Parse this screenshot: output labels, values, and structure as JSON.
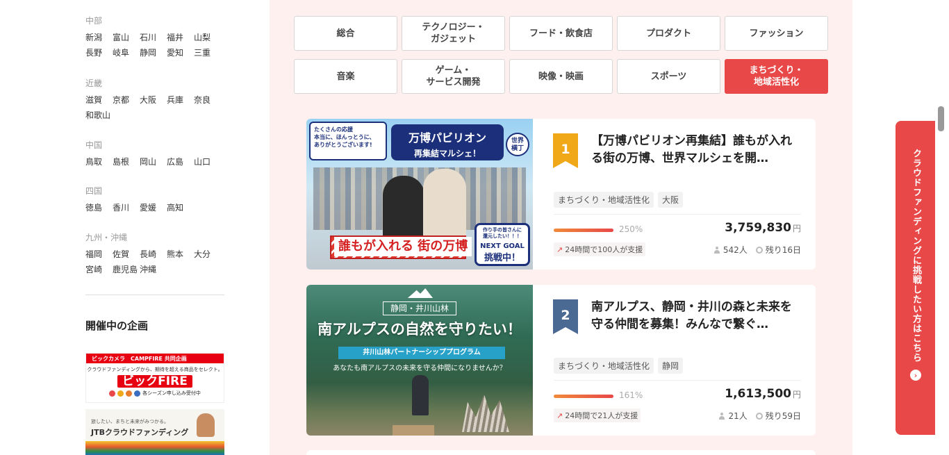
{
  "regions": [
    {
      "name": "中部",
      "rows": [
        [
          "新潟",
          "富山",
          "石川",
          "福井",
          "山梨"
        ],
        [
          "長野",
          "岐阜",
          "静岡",
          "愛知",
          "三重"
        ]
      ]
    },
    {
      "name": "近畿",
      "rows": [
        [
          "滋賀",
          "京都",
          "大阪",
          "兵庫",
          "奈良"
        ],
        [
          "和歌山"
        ]
      ]
    },
    {
      "name": "中国",
      "rows": [
        [
          "鳥取",
          "島根",
          "岡山",
          "広島",
          "山口"
        ]
      ]
    },
    {
      "name": "四国",
      "rows": [
        [
          "徳島",
          "香川",
          "愛媛",
          "高知"
        ]
      ]
    },
    {
      "name": "九州・沖縄",
      "rows": [
        [
          "福岡",
          "佐賀",
          "長崎",
          "熊本",
          "大分"
        ],
        [
          "宮崎",
          "鹿児島",
          "沖縄"
        ]
      ]
    }
  ],
  "sidebar": {
    "section_title": "開催中の企画",
    "banner1": {
      "top": "ビックカメラ",
      "top2": "CAMPFIRE 共同企画",
      "sub": "クラウドファンディングから、期待を超える商品をセレクト。",
      "logo": "ビックFIRE",
      "foot": "各シーズン申し込み受付中"
    },
    "banner2": {
      "small": "旅したい、まちと未来がみつかる。",
      "title": "JTBクラウドファンディング"
    }
  },
  "categories": [
    {
      "label": "総合",
      "active": false
    },
    {
      "label": "テクノロジー・\nガジェット",
      "active": false
    },
    {
      "label": "フード・飲食店",
      "active": false
    },
    {
      "label": "プロダクト",
      "active": false
    },
    {
      "label": "ファッション",
      "active": false
    },
    {
      "label": "音楽",
      "active": false
    },
    {
      "label": "ゲーム・\nサービス開発",
      "active": false
    },
    {
      "label": "映像・映画",
      "active": false
    },
    {
      "label": "スポーツ",
      "active": false
    },
    {
      "label": "まちづくり・\n地域活性化",
      "active": true
    }
  ],
  "projects": [
    {
      "rank": "1",
      "title": "【万博パビリオン再集結】誰もが入れる街の万博、世界マルシェを開…",
      "tags": [
        "まちづくり・地域活性化",
        "大阪"
      ],
      "percent": "250%",
      "amount": "3,759,830",
      "currency": "円",
      "trend": "24時間で100人が支援",
      "supporters": "542人",
      "remaining": "残り16日",
      "image": {
        "bubble": "たくさんの応援\n本当に、ほんっとうに、\nありがとうございます!",
        "title1": "万博パビリオン",
        "title2": "再集結マルシェ！",
        "seal": "世界\n横丁",
        "banner": "誰もが入れる 街の万博",
        "goal1": "作り手の皆さんに\n還元したい！！！",
        "goal2": "NEXT GOAL",
        "goal3": "挑戦中！"
      }
    },
    {
      "rank": "2",
      "title": "南アルプス、静岡・井川の森と未来を守る仲間を募集！みんなで繋ぐ…",
      "tags": [
        "まちづくり・地域活性化",
        "静岡"
      ],
      "percent": "161%",
      "amount": "1,613,500",
      "currency": "円",
      "trend": "24時間で21人が支援",
      "supporters": "21人",
      "remaining": "残り59日",
      "image": {
        "sub": "静岡・井川山林",
        "title": "南アルプスの自然を守りたい！",
        "program": "井川山林パートナーシッププログラム",
        "question": "あなたも南アルプスの未来を守る仲間になりませんか？"
      }
    }
  ],
  "side_cta": {
    "label": "クラウドファンディングに挑戦したい方はこちら",
    "arrow": "›"
  },
  "colors": {
    "accent": "#e84848",
    "rank1": "#f0a818",
    "rank2": "#4b6a93",
    "main_bg": "#fdf0ef"
  }
}
